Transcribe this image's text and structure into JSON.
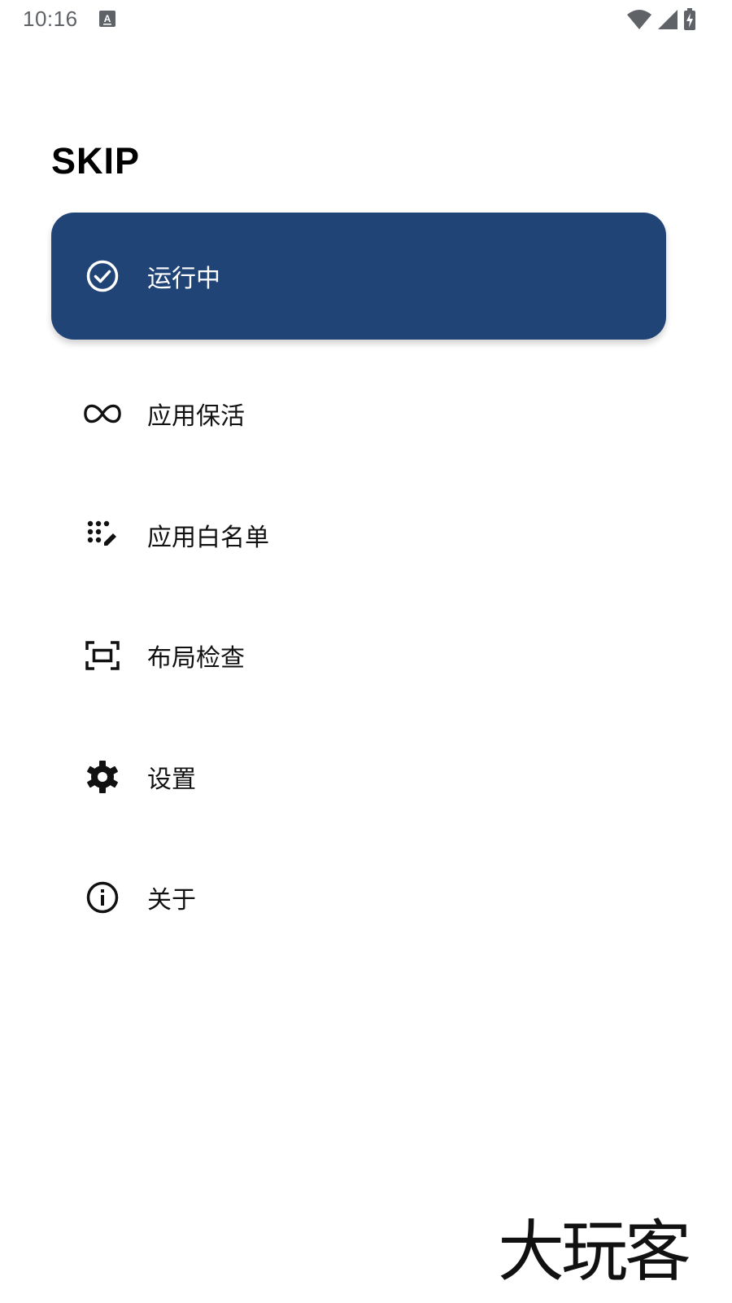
{
  "status_bar": {
    "time": "10:16",
    "icons": [
      "text-a-icon",
      "wifi-icon",
      "signal-icon",
      "battery-charging-icon"
    ]
  },
  "app": {
    "title": "SKIP"
  },
  "menu": {
    "items": [
      {
        "label": "运行中",
        "icon": "check-circle-icon"
      },
      {
        "label": "应用保活",
        "icon": "infinity-icon"
      },
      {
        "label": "应用白名单",
        "icon": "dots-edit-icon"
      },
      {
        "label": "布局检查",
        "icon": "scan-frame-icon"
      },
      {
        "label": "设置",
        "icon": "gear-icon"
      },
      {
        "label": "关于",
        "icon": "info-icon"
      }
    ],
    "active_index": 0
  },
  "watermark": {
    "text": "大玩客"
  },
  "colors": {
    "accent": "#214477",
    "status_gray": "#5f6368",
    "text": "#111111",
    "background": "#ffffff"
  }
}
